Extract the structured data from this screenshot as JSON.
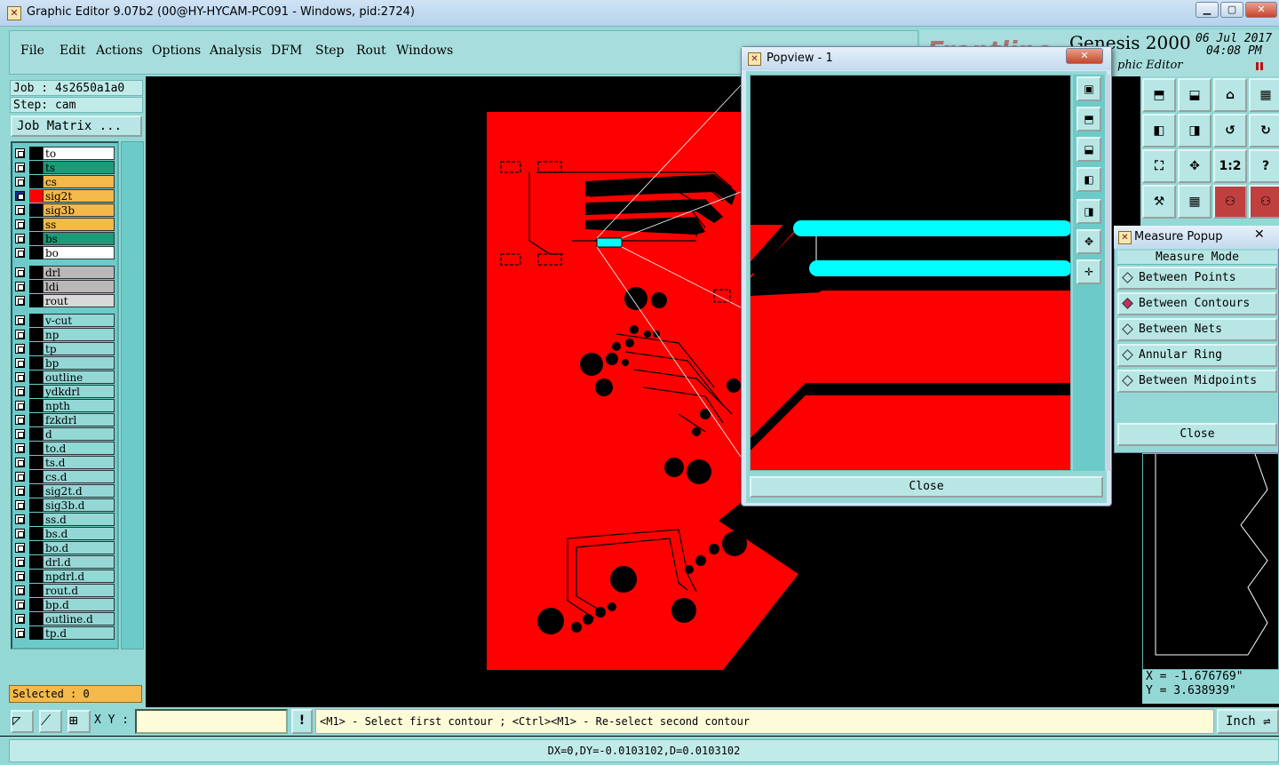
{
  "window": {
    "title": "Graphic Editor 9.07b2 (00@HY-HYCAM-PC091 - Windows, pid:2724)",
    "icon": "app-icon"
  },
  "menu": [
    "File",
    "Edit",
    "Actions",
    "Options",
    "Analysis",
    "DFM",
    "Step",
    "Rout",
    "Windows"
  ],
  "brand": {
    "product": "Genesis 2000",
    "date": "06 Jul 2017",
    "time": "04:08 PM",
    "subtitle": "phic Editor",
    "logo_text": "Frontline"
  },
  "job": {
    "job_label": "Job : 4s2650a1a0",
    "step_label": "Step: cam",
    "matrix_button": "Job Matrix ..."
  },
  "layers": {
    "group1": [
      {
        "name": "to",
        "color": "#ffffff"
      },
      {
        "name": "ts",
        "color": "#1e9a78"
      },
      {
        "name": "cs",
        "color": "#f5b84a"
      },
      {
        "name": "sig2t",
        "color": "#f5b84a",
        "active": true
      },
      {
        "name": "sig3b",
        "color": "#f5b84a"
      },
      {
        "name": "ss",
        "color": "#f5b84a"
      },
      {
        "name": "bs",
        "color": "#1e9a78"
      },
      {
        "name": "bo",
        "color": "#ffffff"
      }
    ],
    "group2": [
      {
        "name": "drl",
        "color": "#b8b8b8"
      },
      {
        "name": "ldi",
        "color": "#b8b8b8"
      },
      {
        "name": "rout",
        "color": "#d9d9d9"
      }
    ],
    "group3": [
      "v-cut",
      "np",
      "tp",
      "bp",
      "outline",
      "ydkdrl",
      "npth",
      "fzkdrl",
      "d",
      "to.d",
      "ts.d",
      "cs.d",
      "sig2t.d",
      "sig3b.d",
      "ss.d",
      "bs.d",
      "bo.d",
      "drl.d",
      "npdrl.d",
      "rout.d",
      "bp.d",
      "outline.d",
      "tp.d"
    ]
  },
  "selected": "Selected : 0",
  "popview": {
    "title": "Popview - 1",
    "close_label": "Close"
  },
  "measure": {
    "title": "Measure Popup",
    "mode_label": "Measure Mode",
    "options": [
      {
        "label": "Between Points",
        "selected": false
      },
      {
        "label": "Between Contours",
        "selected": true
      },
      {
        "label": "Between Nets",
        "selected": false
      },
      {
        "label": "Annular Ring",
        "selected": false
      },
      {
        "label": "Between Midpoints",
        "selected": false
      }
    ],
    "close_label": "Close"
  },
  "coords": {
    "x": "X = -1.676769\"",
    "y": "Y = 3.638939\""
  },
  "bottom": {
    "xy_label": "X Y :",
    "xy_value": "",
    "excl": "!",
    "prompt": "<M1> - Select first contour ; <Ctrl><M1> - Re-select second contour",
    "unit": "Inch"
  },
  "status": "DX=0,DY=-0.0103102,D=0.0103102",
  "right_tools": {
    "ratio_label": "1:2",
    "help_label": "?"
  },
  "colors": {
    "panel": "#94d8d6",
    "copper": "#ff0000",
    "highlight": "#00ffff"
  }
}
